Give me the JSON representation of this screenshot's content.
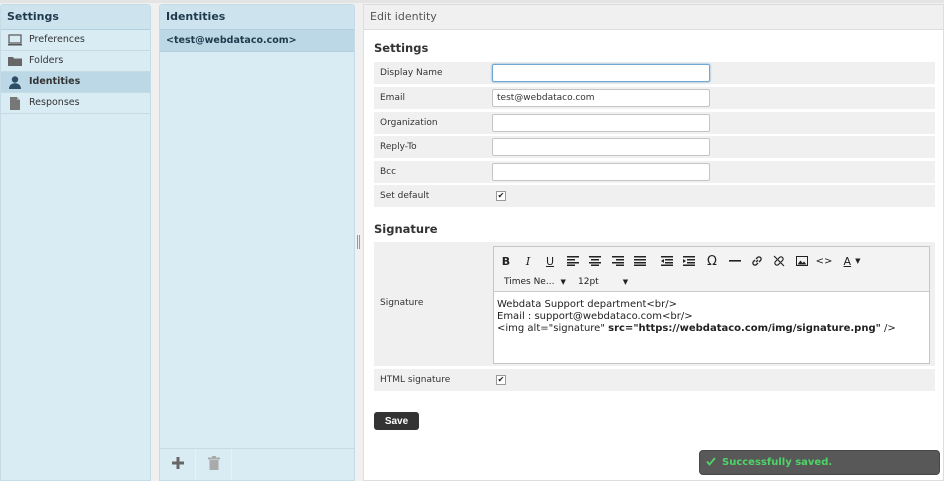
{
  "settings_panel": {
    "title": "Settings",
    "items": [
      {
        "label": "Preferences",
        "icon": "monitor-icon"
      },
      {
        "label": "Folders",
        "icon": "folder-icon"
      },
      {
        "label": "Identities",
        "icon": "person-icon"
      },
      {
        "label": "Responses",
        "icon": "document-icon"
      }
    ]
  },
  "identities_panel": {
    "title": "Identities",
    "items": [
      "<test@webdataco.com>"
    ]
  },
  "edit_panel": {
    "title": "Edit identity",
    "settings_section": "Settings",
    "fields": {
      "display_name": {
        "label": "Display Name",
        "value": ""
      },
      "email": {
        "label": "Email",
        "value": "test@webdataco.com"
      },
      "organization": {
        "label": "Organization",
        "value": ""
      },
      "reply_to": {
        "label": "Reply-To",
        "value": ""
      },
      "bcc": {
        "label": "Bcc",
        "value": ""
      },
      "set_default": {
        "label": "Set default",
        "checked": "✔"
      }
    },
    "signature_section": "Signature",
    "signature": {
      "label": "Signature",
      "font_family": "Times Ne...",
      "font_size": "12pt",
      "line1": "Webdata Support department<br/>",
      "line2": "Email : support@webdataco.com<br/>",
      "line3_a": "<img alt=\"signature\" ",
      "line3_b": "src=\"https://webdataco.com/img/signature.png\"",
      "line3_c": " />"
    },
    "html_signature": {
      "label": "HTML signature",
      "checked": "✔"
    },
    "save_label": "Save"
  },
  "toast": {
    "message": "Successfully saved.",
    "icon": "check-icon"
  },
  "colors": {
    "accent": "#4fd468",
    "panel_bg": "#d9ecf4",
    "selected_bg": "#bcd8e6"
  }
}
